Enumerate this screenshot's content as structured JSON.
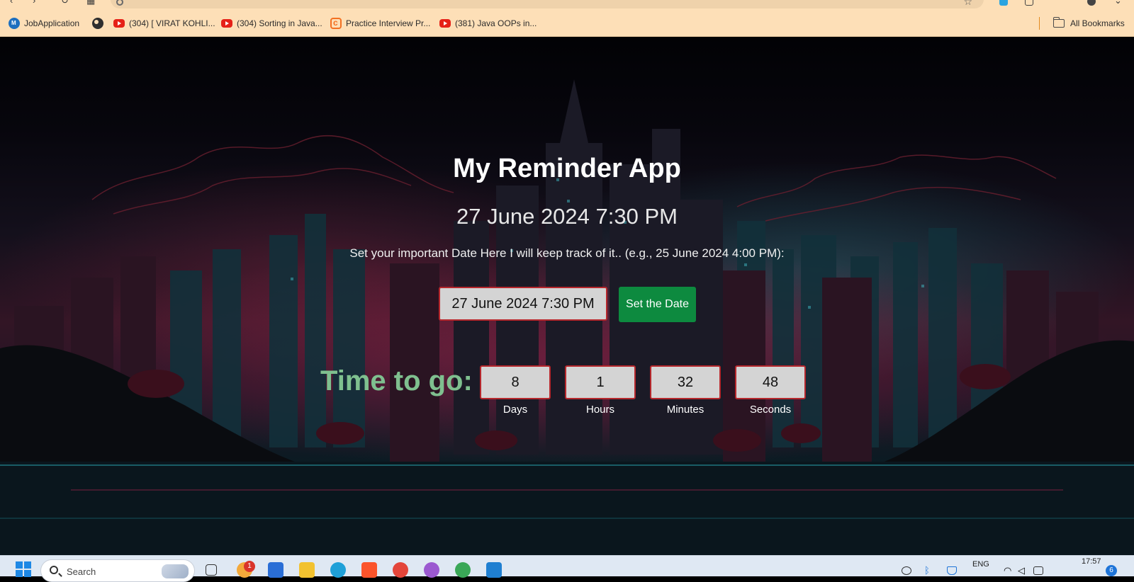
{
  "browser": {
    "bookmarks": [
      {
        "label": "JobApplication",
        "icon": "job-application-icon"
      },
      {
        "label": "",
        "icon": "globe-icon"
      },
      {
        "label": "(304) [ VIRAT KOHLI...",
        "icon": "youtube-icon"
      },
      {
        "label": "(304) Sorting in Java...",
        "icon": "youtube-icon"
      },
      {
        "label": "Practice Interview Pr...",
        "icon": "geeksforgeeks-icon"
      },
      {
        "label": "(381) Java OOPs in...",
        "icon": "youtube-icon"
      }
    ],
    "all_bookmarks_label": "All Bookmarks",
    "colors": {
      "chrome": "#fddfb7",
      "omnibox": "#efd2ab",
      "separator": "#e38b1f"
    }
  },
  "app": {
    "title": "My Reminder App",
    "current_date": "27 June 2024 7:30 PM",
    "instruction": "Set your important Date Here I will keep track of it.. (e.g., 25 June 2024 4:00 PM):",
    "date_input_value": "27 June 2024 7:30 PM",
    "set_button_label": "Set the Date",
    "time_to_go_label": "Time to go:",
    "countdown": [
      {
        "value": "8",
        "label": "Days"
      },
      {
        "value": "1",
        "label": "Hours"
      },
      {
        "value": "32",
        "label": "Minutes"
      },
      {
        "value": "48",
        "label": "Seconds"
      }
    ],
    "colors": {
      "button": "#0d8a3f",
      "box_border": "#b6272c",
      "box_bg": "#d4d4d4",
      "time_to_go": "#7fc08f"
    }
  },
  "taskbar": {
    "search_placeholder": "Search",
    "badge_count": "1",
    "language": "ENG",
    "time": "17:57",
    "notification_count": "6"
  }
}
